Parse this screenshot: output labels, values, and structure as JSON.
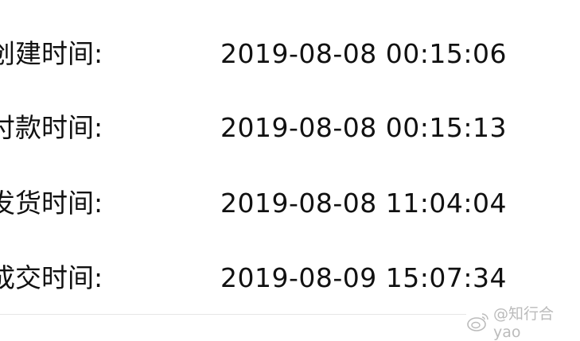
{
  "rows": [
    {
      "label": "创建时间:",
      "value": "2019-08-08 00:15:06"
    },
    {
      "label": "付款时间:",
      "value": "2019-08-08 00:15:13"
    },
    {
      "label": "发货时间:",
      "value": "2019-08-08 11:04:04"
    },
    {
      "label": "成交时间:",
      "value": "2019-08-09 15:07:34"
    }
  ],
  "watermark": "@知行合yao"
}
